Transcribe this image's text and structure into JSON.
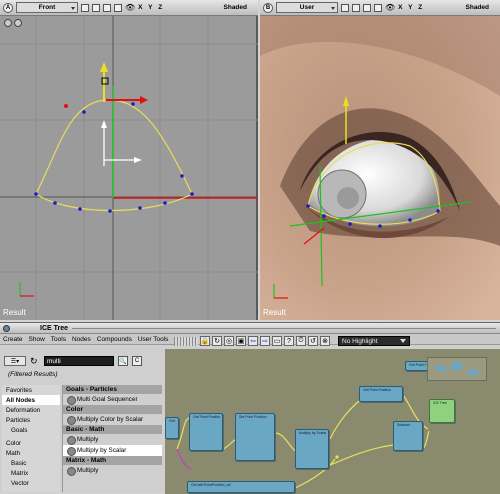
{
  "viewports": {
    "left": {
      "letter": "A",
      "name": "Front",
      "axes": "X Y Z",
      "shading": "Shaded",
      "result": "Result"
    },
    "right": {
      "letter": "B",
      "name": "User",
      "axes": "X Y Z",
      "shading": "Shaded",
      "result": "Result"
    }
  },
  "ice_tree": {
    "title": "ICE Tree",
    "menu": [
      "Create",
      "Show",
      "Tools",
      "Nodes",
      "Compounds",
      "User Tools"
    ],
    "highlight_dropdown": "No Highlight",
    "search_value": "multi",
    "filter_label": "(Filtered Results)",
    "categories": [
      "Favorites",
      "All Nodes",
      "Deformation",
      "Particles",
      "Goals",
      "Color",
      "Math",
      "Basic",
      "Matrix",
      "Vector"
    ],
    "selected_category": "All Nodes",
    "sections": [
      {
        "header": "Goals - Particles",
        "items": [
          "Multi Goal Sequencer"
        ]
      },
      {
        "header": "Color",
        "items": [
          "Multiply Color by Scalar"
        ]
      },
      {
        "header": "Basic - Math",
        "items": [
          "Multiply",
          "Multiply by Scalar"
        ]
      },
      {
        "header": "Matrix - Math",
        "items": [
          "Multiply"
        ]
      }
    ],
    "selected_item": "Multiply by Scalar",
    "nodes": [
      {
        "title": "Get Point Position"
      },
      {
        "title": "Get Point Position"
      },
      {
        "title": "Set Point Position"
      },
      {
        "title": "Multiply by Scalar"
      },
      {
        "title": "Get Point Position"
      },
      {
        "title": "Subtract"
      },
      {
        "title": "Get Point Position"
      },
      {
        "title": "ICE Tree"
      },
      {
        "title": "Get self.PointPosition_ref"
      }
    ],
    "colors": {
      "node_blue": "#6aa7c4",
      "node_green": "#8fd17e",
      "graph_bg": "#8a8a6e",
      "wire_yellow": "#e8e060"
    }
  }
}
